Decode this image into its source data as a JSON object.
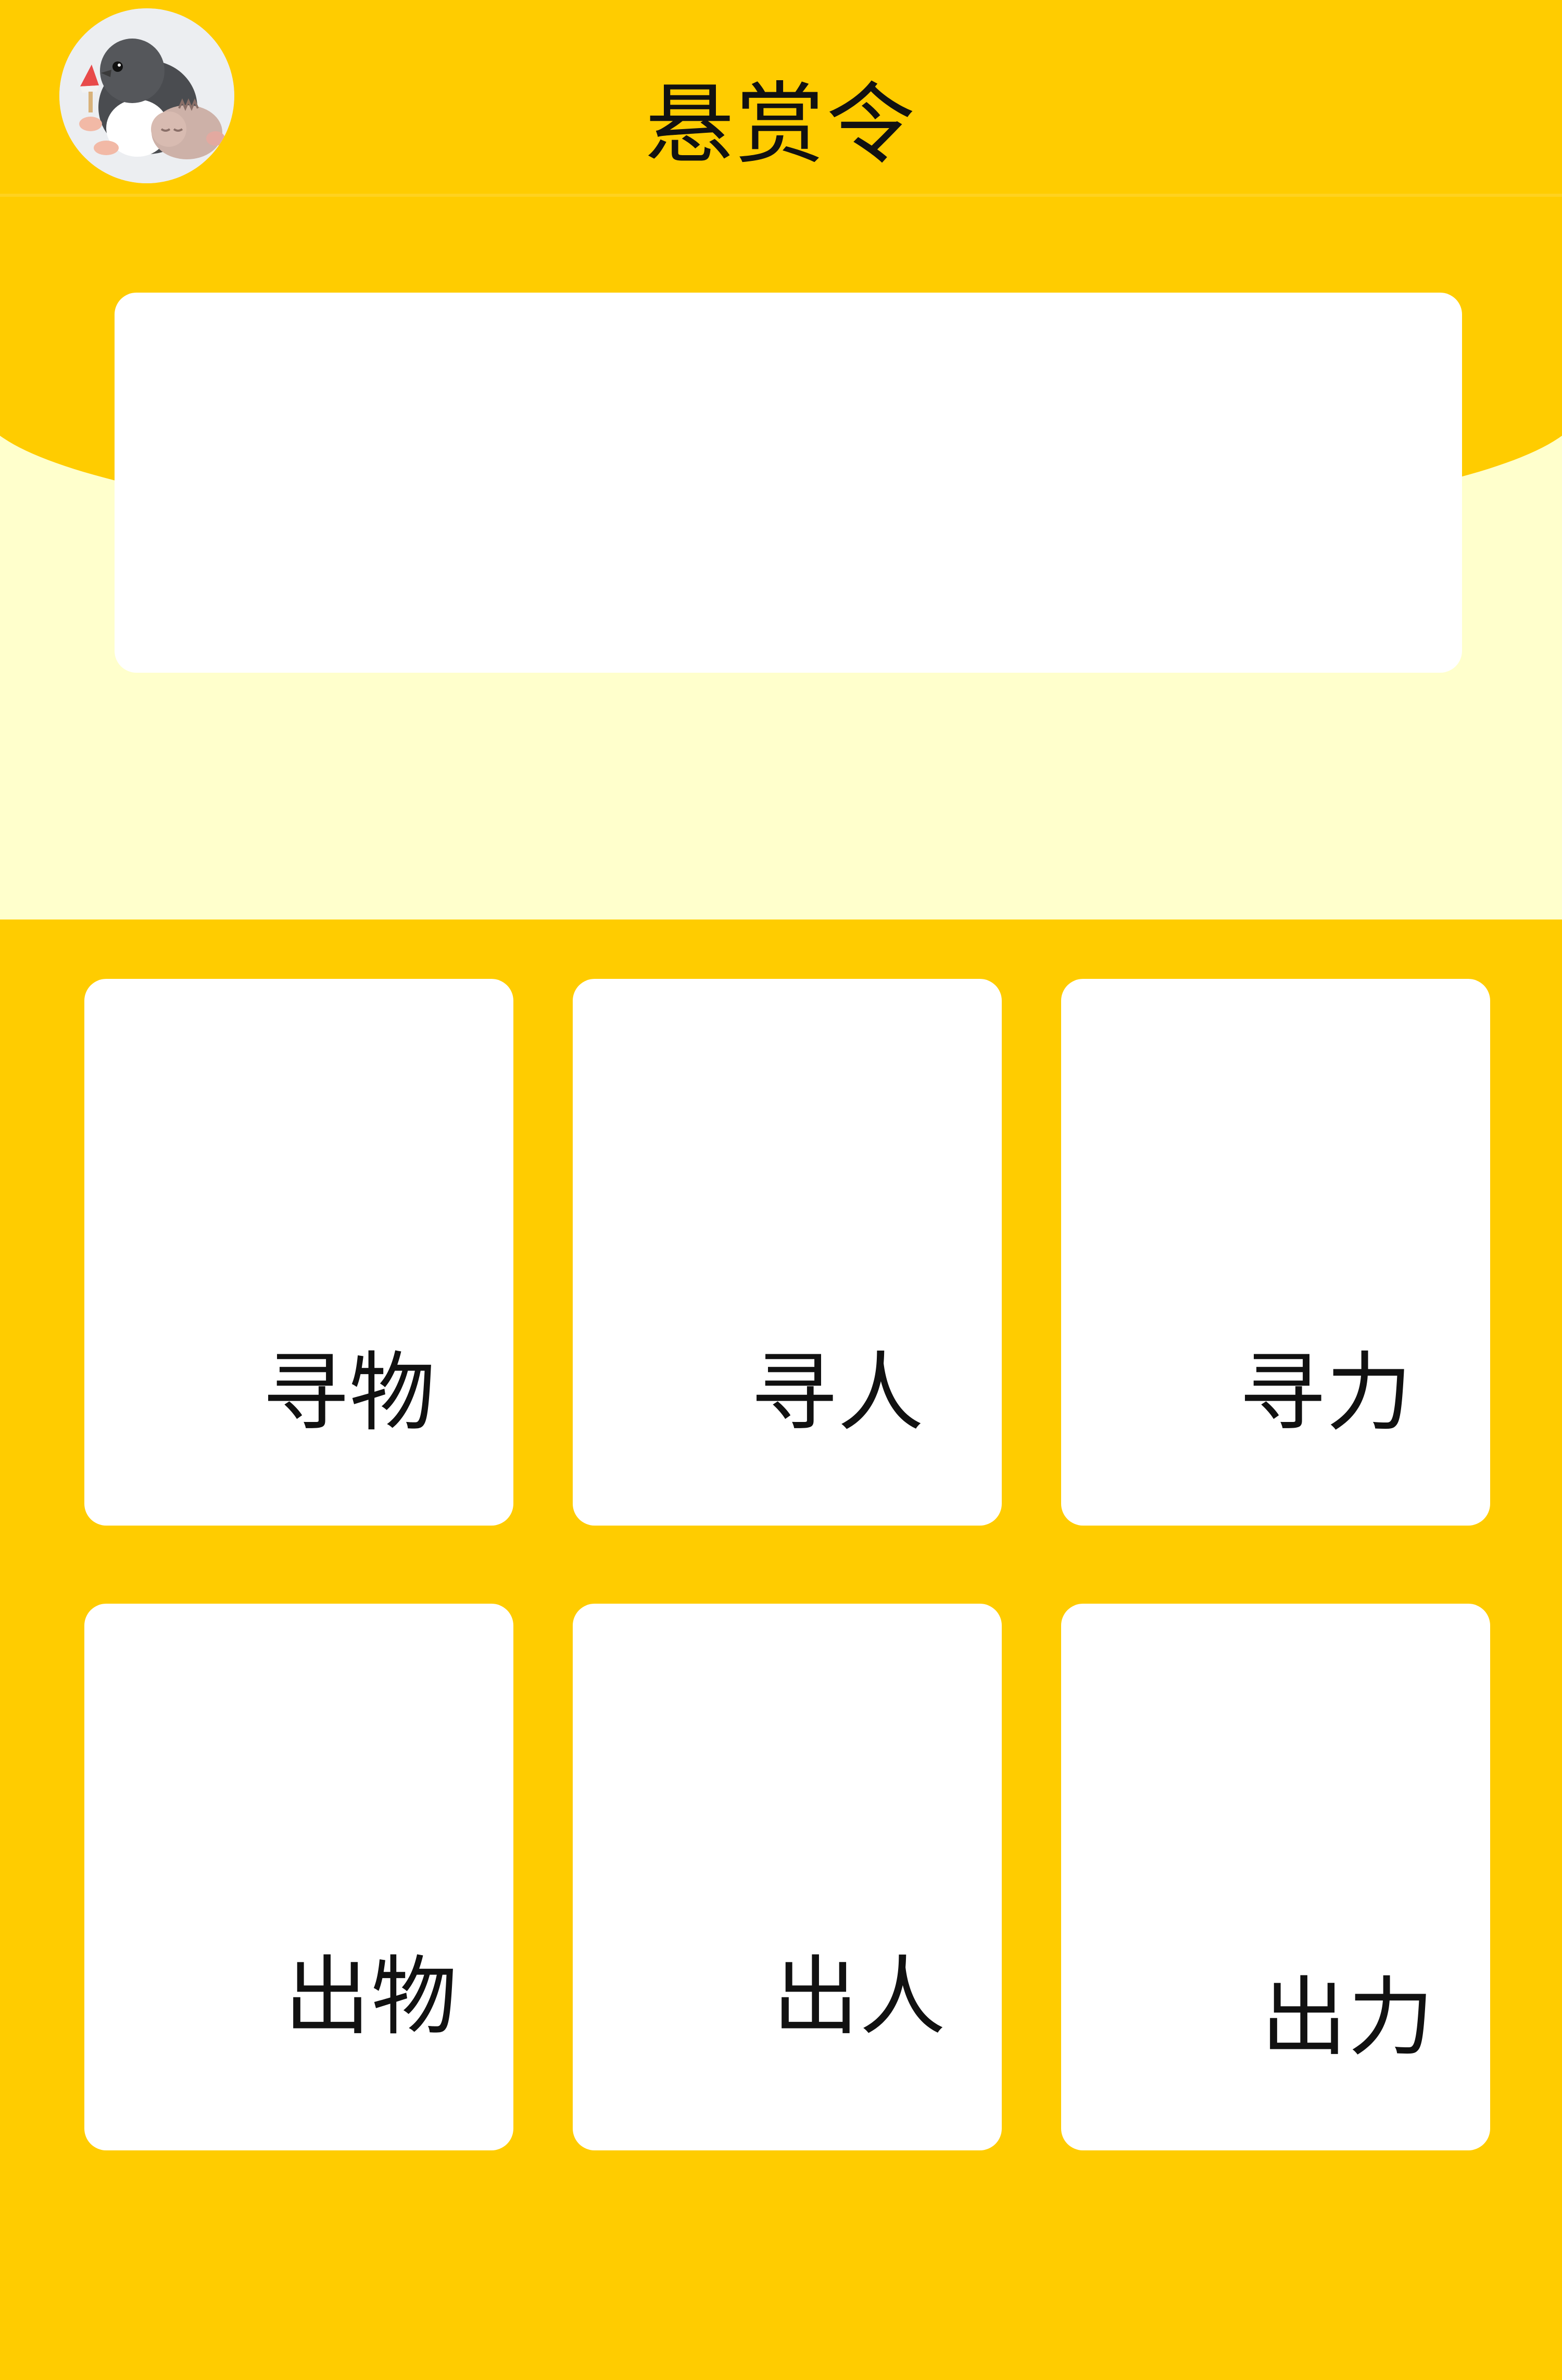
{
  "header": {
    "title": "悬赏令",
    "avatar_icon": "penguin-mascot-icon"
  },
  "banner": {
    "image_alt": ""
  },
  "categories": [
    {
      "label": "寻物"
    },
    {
      "label": "寻人"
    },
    {
      "label": "寻力"
    },
    {
      "label": "出物"
    },
    {
      "label": "出人"
    },
    {
      "label": "出力"
    }
  ],
  "colors": {
    "primary": "#FFCC00",
    "banner_background": "#FFFFCC",
    "card": "#FFFFFF",
    "text": "#111111"
  }
}
